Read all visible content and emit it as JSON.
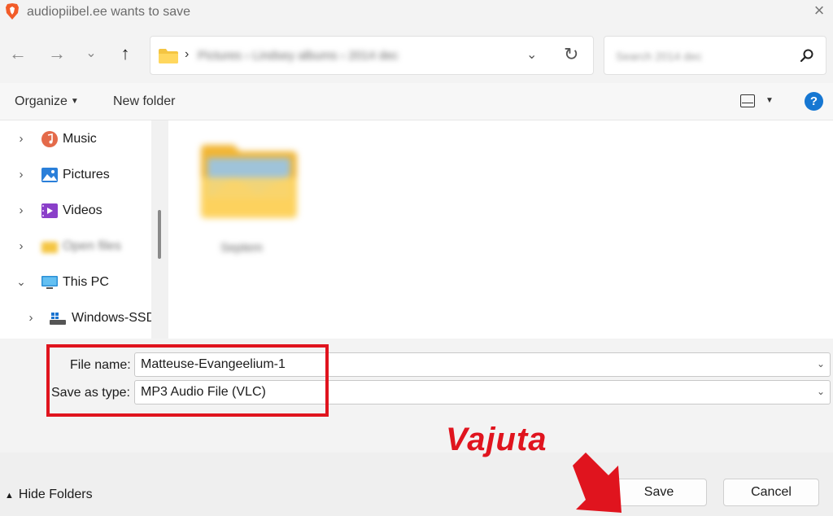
{
  "window": {
    "title": "audiopiibel.ee wants to save"
  },
  "address": {
    "path": "Pictures  ›  Lindsey albums  ›  2014 dec"
  },
  "search": {
    "placeholder": "Search 2014 dec"
  },
  "toolbar": {
    "organize_label": "Organize",
    "new_folder_label": "New folder",
    "help_label": "?"
  },
  "nav": {
    "items": [
      {
        "label": "Music",
        "icon": "music-icon",
        "expanded": false
      },
      {
        "label": "Pictures",
        "icon": "pictures-icon",
        "expanded": false
      },
      {
        "label": "Videos",
        "icon": "videos-icon",
        "expanded": false
      },
      {
        "label": "Open files",
        "icon": "folder-icon",
        "expanded": false
      },
      {
        "label": "This PC",
        "icon": "computer-icon",
        "expanded": true
      },
      {
        "label": "Windows-SSD",
        "icon": "drive-icon",
        "expanded": false
      }
    ]
  },
  "content": {
    "items": [
      {
        "name": "Septem",
        "icon": "folder-icon"
      }
    ]
  },
  "form": {
    "file_name_label": "File name:",
    "file_name_value": "Matteuse-Evangeelium-1",
    "save_type_label": "Save as type:",
    "save_type_value": "MP3 Audio File (VLC)"
  },
  "footer": {
    "hide_folders_label": "Hide Folders",
    "save_label": "Save",
    "cancel_label": "Cancel"
  },
  "annotation": {
    "text": "Vajuta",
    "color": "#e0141e"
  },
  "colors": {
    "accent": "#1677d2",
    "annotation_red": "#e0141e"
  }
}
